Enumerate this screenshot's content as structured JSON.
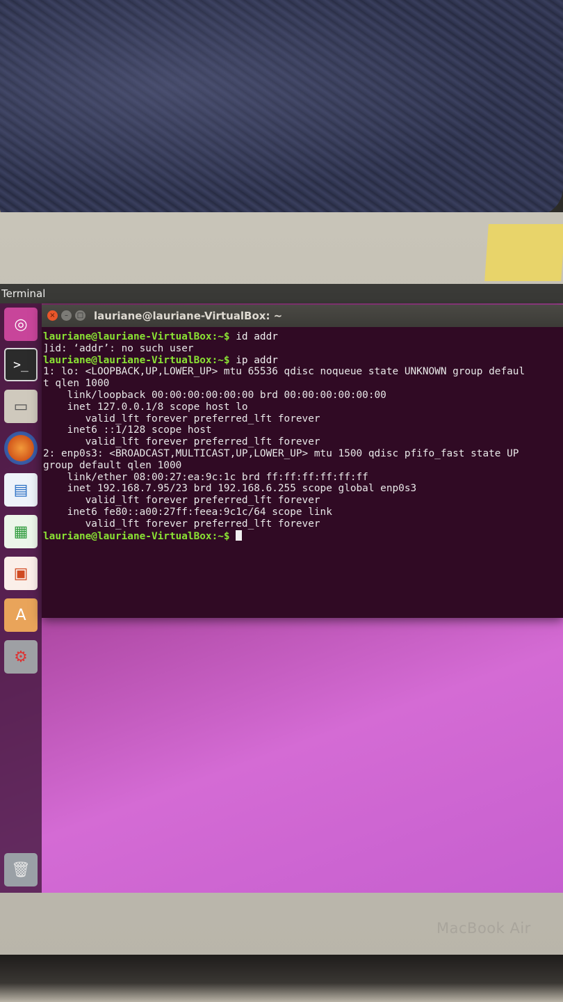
{
  "photo": {
    "bezel_logo": "MacBook Air"
  },
  "topbar": {
    "title": "Terminal"
  },
  "launcher": {
    "items": [
      {
        "name": "ubuntu-dash",
        "glyph": "◎"
      },
      {
        "name": "terminal",
        "glyph": ">_"
      },
      {
        "name": "files",
        "glyph": "▭"
      },
      {
        "name": "firefox",
        "glyph": ""
      },
      {
        "name": "libreoffice-writer",
        "glyph": "▤"
      },
      {
        "name": "libreoffice-calc",
        "glyph": "▦"
      },
      {
        "name": "libreoffice-impress",
        "glyph": "▣"
      },
      {
        "name": "software-center",
        "glyph": "A"
      },
      {
        "name": "system-settings",
        "glyph": "⚙"
      },
      {
        "name": "trash",
        "glyph": "🗑"
      }
    ]
  },
  "terminal": {
    "title": "lauriane@lauriane-VirtualBox: ~",
    "prompt": "lauriane@lauriane-VirtualBox:~$",
    "lines": [
      {
        "prompt": "lauriane@lauriane-VirtualBox:~$",
        "cmd": " id addr"
      },
      {
        "text": "]id: ‘addr’: no such user"
      },
      {
        "prompt": "lauriane@lauriane-VirtualBox:~$",
        "cmd": " ip addr"
      },
      {
        "text": "1: lo: <LOOPBACK,UP,LOWER_UP> mtu 65536 qdisc noqueue state UNKNOWN group defaul"
      },
      {
        "text": "t qlen 1000"
      },
      {
        "text": "    link/loopback 00:00:00:00:00:00 brd 00:00:00:00:00:00"
      },
      {
        "text": "    inet 127.0.0.1/8 scope host lo"
      },
      {
        "text": "       valid_lft forever preferred_lft forever"
      },
      {
        "text": "    inet6 ::1/128 scope host"
      },
      {
        "text": "       valid_lft forever preferred_lft forever"
      },
      {
        "text": "2: enp0s3: <BROADCAST,MULTICAST,UP,LOWER_UP> mtu 1500 qdisc pfifo_fast state UP"
      },
      {
        "text": "group default qlen 1000"
      },
      {
        "text": "    link/ether 08:00:27:ea:9c:1c brd ff:ff:ff:ff:ff:ff"
      },
      {
        "text": "    inet 192.168.7.95/23 brd 192.168.6.255 scope global enp0s3"
      },
      {
        "text": "       valid_lft forever preferred_lft forever"
      },
      {
        "text": "    inet6 fe80::a00:27ff:feea:9c1c/64 scope link"
      },
      {
        "text": "       valid_lft forever preferred_lft forever"
      },
      {
        "prompt": "lauriane@lauriane-VirtualBox:~$",
        "cmd": " ",
        "cursor": true
      }
    ]
  },
  "colors": {
    "terminal_bg": "#300a24",
    "prompt_green": "#8ae234",
    "desktop_accent": "#c65fcf"
  }
}
